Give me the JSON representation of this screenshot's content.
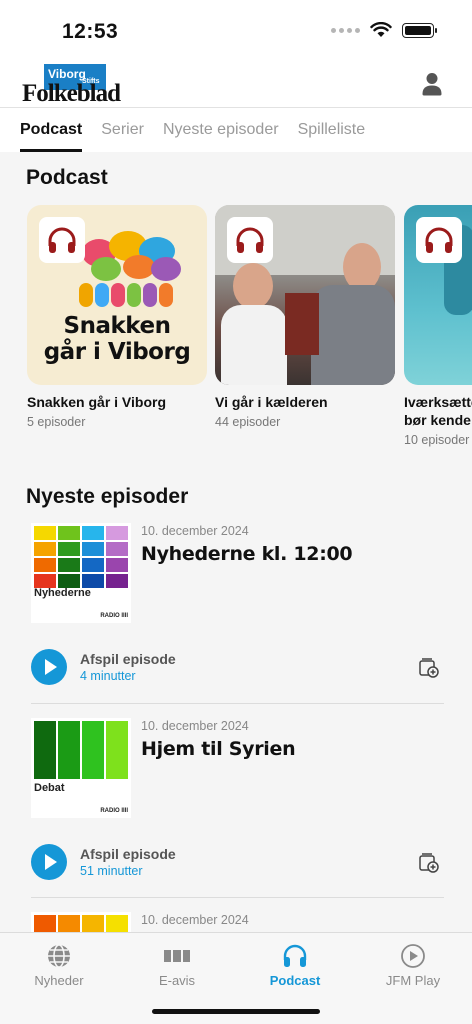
{
  "status_bar": {
    "time": "12:53"
  },
  "header": {
    "logo_box_line1": "Viborg",
    "logo_box_line2": "Stifts",
    "logo_word": "Folkeblad",
    "profile_icon": "user-icon"
  },
  "tabs": [
    {
      "label": "Podcast",
      "active": true
    },
    {
      "label": "Serier",
      "active": false
    },
    {
      "label": "Nyeste episoder",
      "active": false
    },
    {
      "label": "Spilleliste",
      "active": false
    }
  ],
  "podcast_section": {
    "title": "Podcast",
    "cards": [
      {
        "title": "Snakken går i Viborg",
        "subtitle": "5 episoder",
        "art_text_line1": "Snakken",
        "art_text_line2": "går i Viborg",
        "badge_icon": "headphones-icon"
      },
      {
        "title": "Vi går i kælderen",
        "subtitle": "44 episoder",
        "badge_icon": "headphones-icon"
      },
      {
        "title_line1": "Iværksætte",
        "title_line2": "bør kende",
        "subtitle": "10 episoder",
        "badge_icon": "headphones-icon"
      }
    ]
  },
  "episodes_section": {
    "title": "Nyeste episoder",
    "episodes": [
      {
        "date": "10. december 2024",
        "title": "Nyhederne kl. 12:00",
        "thumb_label": "Nyhederne",
        "thumb_radio": "RADIO IIII",
        "play_label": "Afspil episode",
        "duration": "4 minutter"
      },
      {
        "date": "10. december 2024",
        "title": "Hjem til Syrien",
        "thumb_label": "Debat",
        "thumb_radio": "RADIO IIII",
        "play_label": "Afspil episode",
        "duration": "51 minutter"
      },
      {
        "date": "10. december 2024"
      }
    ],
    "colors": {
      "nyhederne": [
        [
          "#f5d800",
          "#6fc31c",
          "#27b5ec",
          "#d69adf"
        ],
        [
          "#f5a300",
          "#2f9b1f",
          "#1d8fd8",
          "#b46cc6"
        ],
        [
          "#ef6a00",
          "#1a7a18",
          "#1468c4",
          "#9a45ad"
        ],
        [
          "#e6351d",
          "#0e5e13",
          "#0d4aa8",
          "#76228f"
        ]
      ],
      "debat": [
        "#0f6a0f",
        "#1b9b15",
        "#2fc21f",
        "#7ee11c"
      ],
      "third": [
        "#ef5a00",
        "#f58a00",
        "#f5b500",
        "#f5e000"
      ],
      "accent": "#1597d7"
    }
  },
  "bottom_nav": [
    {
      "label": "Nyheder",
      "icon": "globe-icon",
      "active": false
    },
    {
      "label": "E-avis",
      "icon": "newspaper-icon",
      "active": false
    },
    {
      "label": "Podcast",
      "icon": "headphones-icon",
      "active": true
    },
    {
      "label": "JFM Play",
      "icon": "play-circle-icon",
      "active": false
    }
  ]
}
